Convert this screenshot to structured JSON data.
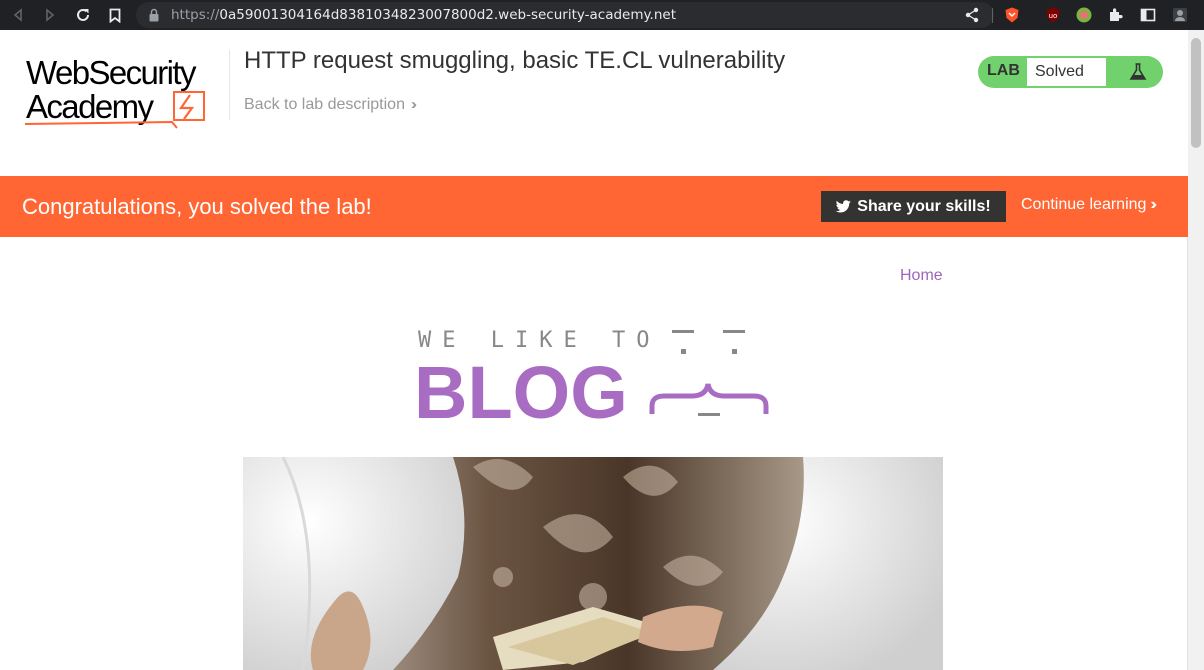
{
  "browser": {
    "url_scheme": "https://",
    "url_host": "0a59001304164d8381034823007800d2.web-security-academy.net"
  },
  "header": {
    "logo_line1": "WebSecurity",
    "logo_line2": "Academy",
    "lab_title": "HTTP request smuggling, basic TE.CL vulnerability",
    "back_link": "Back to lab description",
    "lab_label": "LAB",
    "lab_status": "Solved"
  },
  "banner": {
    "message": "Congratulations, you solved the lab!",
    "share_label": "Share your skills!",
    "continue_label": "Continue learning"
  },
  "blog": {
    "home_link": "Home",
    "logo_small": "WE LIKE TO",
    "logo_big": "BLOG"
  },
  "colors": {
    "brand_orange": "#ff6633",
    "lab_green": "#70d16d",
    "blog_purple": "#9e65be",
    "chrome_dark": "#202124"
  },
  "icons": [
    "back-icon",
    "forward-icon",
    "reload-icon",
    "bookmark-icon",
    "lock-icon",
    "share-icon",
    "brave-shield-icon",
    "ublock-icon",
    "extension-green-icon",
    "extensions-puzzle-icon",
    "sidebar-icon",
    "profile-icon",
    "twitter-icon",
    "flask-icon"
  ]
}
